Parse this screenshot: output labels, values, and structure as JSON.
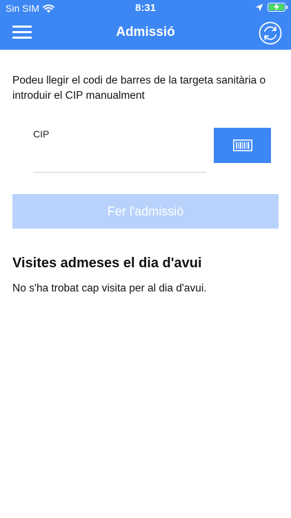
{
  "status_bar": {
    "carrier": "Sin SIM",
    "time": "8:31",
    "battery_color": "#4cd964"
  },
  "header": {
    "title": "Admissió",
    "menu_icon": "hamburger-menu-icon",
    "refresh_icon": "refresh-icon",
    "background_color": "#3d87f5"
  },
  "form": {
    "instructions": "Podeu llegir el codi de barres de la targeta sanitària o introduir el CIP manualment",
    "cip_label": "CIP",
    "cip_value": "",
    "scan_icon": "barcode-icon",
    "submit_label": "Fer l'admissió"
  },
  "visits": {
    "title": "Visites admeses el dia d'avui",
    "empty_message": "No s'ha trobat cap visita per al dia d'avui."
  }
}
